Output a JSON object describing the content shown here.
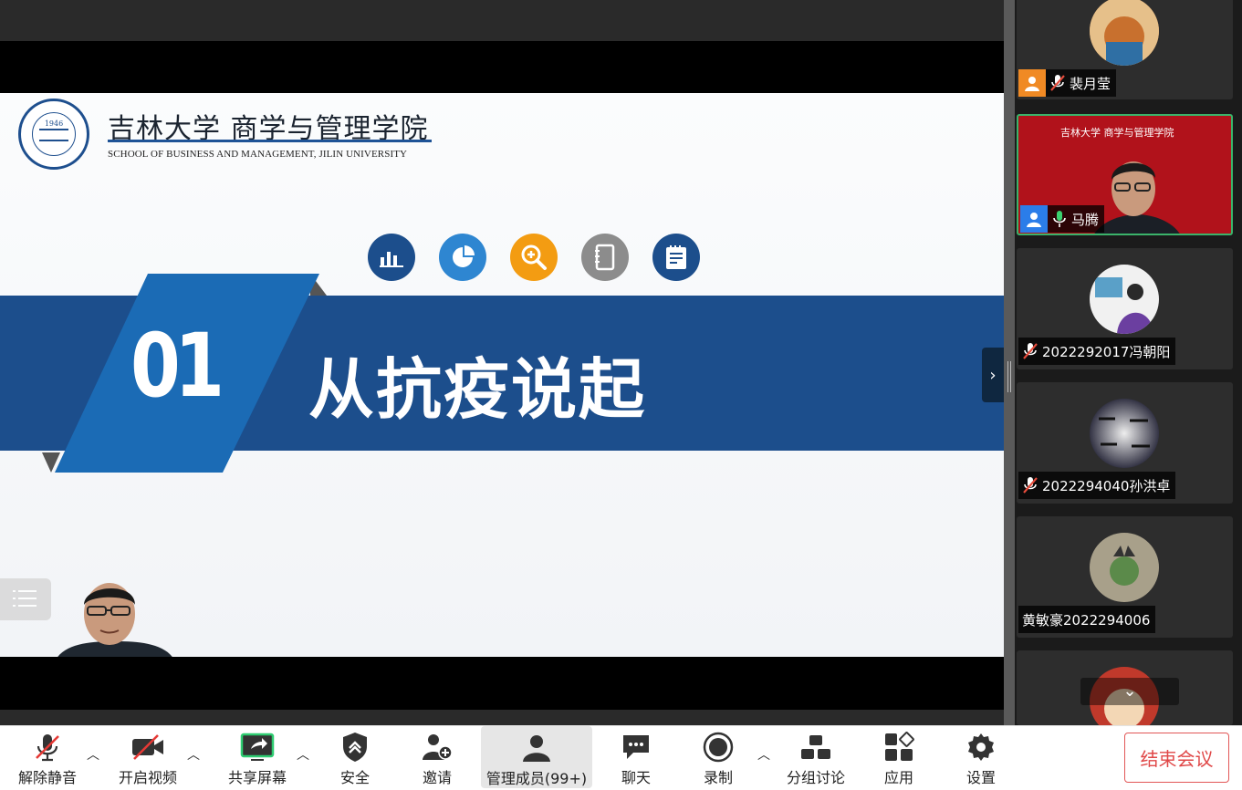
{
  "slide": {
    "school_cn": "吉林大学 商学与管理学院",
    "school_en": "SCHOOL OF BUSINESS AND MANAGEMENT, JILIN UNIVERSITY",
    "seal_year": "1946",
    "section_number": "01",
    "section_title": "从抗疫说起",
    "icons": [
      "bar-chart-icon",
      "pie-chart-icon",
      "zoom-in-icon",
      "notebook-icon",
      "clipboard-icon"
    ]
  },
  "participants": [
    {
      "name": "裴月莹",
      "muted": true,
      "host_badge": true
    },
    {
      "name": "马腾",
      "muted": false,
      "host_badge": true,
      "banner": "吉林大学 商学与管理学院"
    },
    {
      "name": "2022292017冯朝阳",
      "muted": true
    },
    {
      "name": "2022294040孙洪卓",
      "muted": true
    },
    {
      "name": "黄敏豪2022294006",
      "muted": false
    },
    {
      "name": "",
      "muted": false
    }
  ],
  "toolbar": {
    "unmute": "解除静音",
    "start_video": "开启视频",
    "share_screen": "共享屏幕",
    "security": "安全",
    "invite": "邀请",
    "manage_members": "管理成员(99+)",
    "chat": "聊天",
    "record": "录制",
    "breakout": "分组讨论",
    "apps": "应用",
    "settings": "设置",
    "end_meeting": "结束会议"
  },
  "colors": {
    "brand_blue": "#1c4e8c",
    "accent_orange": "#f39c12",
    "end_red": "#e04848",
    "active_border": "#3bb36a"
  }
}
